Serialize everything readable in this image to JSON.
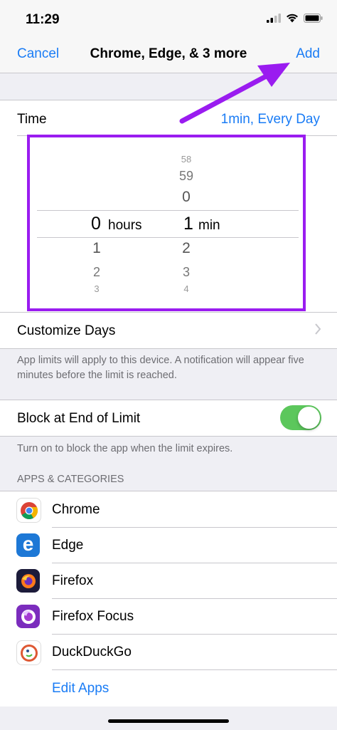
{
  "status_bar": {
    "time": "11:29"
  },
  "nav": {
    "cancel_label": "Cancel",
    "title": "Chrome, Edge, & 3 more",
    "add_label": "Add"
  },
  "time_row": {
    "label": "Time",
    "value": "1min, Every Day"
  },
  "picker": {
    "hours_above": [
      "",
      "",
      ""
    ],
    "hours_selected": "0",
    "hours_unit": "hours",
    "hours_below": [
      "1",
      "2",
      "3"
    ],
    "mins_above": [
      "58",
      "59",
      "0"
    ],
    "mins_selected": "1",
    "mins_unit": "min",
    "mins_below": [
      "2",
      "3",
      "4"
    ]
  },
  "customize_days": {
    "label": "Customize Days"
  },
  "limit_note": "App limits will apply to this device. A notification will appear five minutes before the limit is reached.",
  "block_row": {
    "label": "Block at End of Limit",
    "enabled": true
  },
  "block_note": "Turn on to block the app when the limit expires.",
  "apps_header": "APPS & CATEGORIES",
  "apps": [
    {
      "name": "Chrome",
      "icon": "chrome-icon"
    },
    {
      "name": "Edge",
      "icon": "edge-icon"
    },
    {
      "name": "Firefox",
      "icon": "firefox-icon"
    },
    {
      "name": "Firefox Focus",
      "icon": "firefox-focus-icon"
    },
    {
      "name": "DuckDuckGo",
      "icon": "duckduckgo-icon"
    }
  ],
  "edit_apps_label": "Edit Apps",
  "colors": {
    "accent": "#1a7cf5",
    "highlight": "#9a1cf0",
    "toggle_on": "#5cc75c"
  }
}
